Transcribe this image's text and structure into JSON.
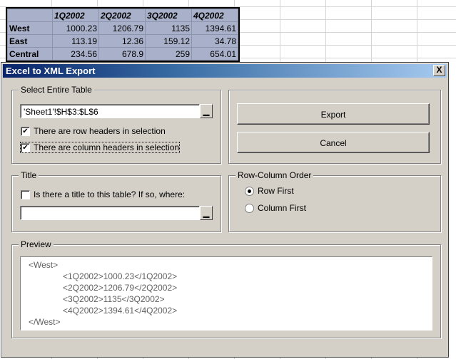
{
  "sheet": {
    "columns": [
      "",
      "1Q2002",
      "2Q2002",
      "3Q2002",
      "4Q2002"
    ],
    "rows": [
      {
        "label": "West",
        "values": [
          "1000.23",
          "1206.79",
          "1135",
          "1394.61"
        ]
      },
      {
        "label": "East",
        "values": [
          "113.19",
          "12.36",
          "159.12",
          "34.78"
        ]
      },
      {
        "label": "Central",
        "values": [
          "234.56",
          "678.9",
          "259",
          "654.01"
        ]
      }
    ]
  },
  "dialog": {
    "title": "Excel to XML Export",
    "close_label": "X",
    "select_table": {
      "label": "Select Entire Table",
      "range_value": "'Sheet1'!$H$3:$L$6",
      "row_headers_label": "There are row headers in selection",
      "row_headers_checked": true,
      "column_headers_label": "There are column headers in selection",
      "column_headers_checked": true
    },
    "buttons": {
      "export": "Export",
      "cancel": "Cancel"
    },
    "title_group": {
      "label": "Title",
      "has_title_label": "Is there a title to this table? If so, where:",
      "has_title_checked": false,
      "title_range_value": ""
    },
    "order": {
      "label": "Row-Column Order",
      "row_first": "Row First",
      "column_first": "Column First",
      "selected": "row_first"
    },
    "preview": {
      "label": "Preview",
      "lines": [
        "<West>",
        "<1Q2002>1000.23</1Q2002>",
        "<2Q2002>1206.79</2Q2002>",
        "<3Q2002>1135</3Q2002>",
        "<4Q2002>1394.61</4Q2002>",
        "</West>"
      ]
    }
  }
}
